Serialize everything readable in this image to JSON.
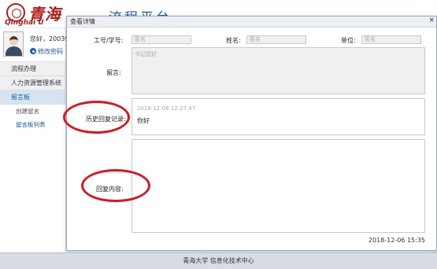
{
  "header": {
    "logo_cn": "青海大学",
    "logo_en": "Qinghai U",
    "platform_title": "流程平台"
  },
  "sidebar": {
    "greeting": "您好，20039",
    "change_password": "修改密码",
    "items": [
      {
        "label": "流程办理"
      },
      {
        "label": "人力资源管理系统"
      },
      {
        "label": "留言板"
      }
    ],
    "subitems": [
      {
        "label": "创建留言"
      },
      {
        "label": "留言板列表"
      }
    ]
  },
  "modal": {
    "title": "查看详情",
    "close": "×",
    "fields": {
      "id_label": "工号/学号:",
      "id_placeholder": "匿名",
      "name_label": "姓名:",
      "name_placeholder": "匿名",
      "unit_label": "单位:",
      "unit_placeholder": "匿名",
      "message_label": "留言:",
      "message_value": "书记您好",
      "history_label": "历史回复记录:",
      "history_time": "2018-12-06 12:27:47",
      "history_message": "你好",
      "reply_label": "回复内容:"
    },
    "timestamp": "2018-12-06 15:35"
  },
  "footer": {
    "text": "青海大学 信息化技术中心"
  },
  "colors": {
    "brand_red": "#b31b1b",
    "accent_blue": "#1b5ca8",
    "annotation_red": "#e0141b"
  }
}
